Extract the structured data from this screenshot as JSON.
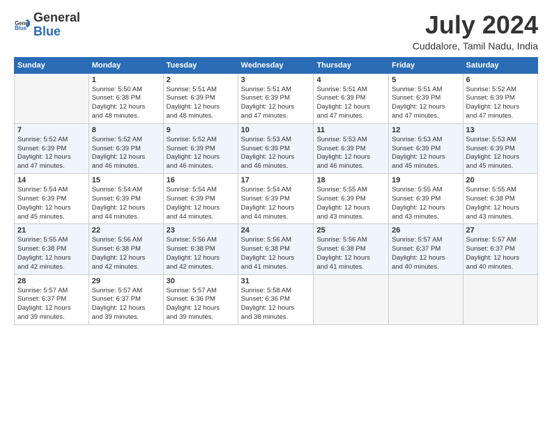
{
  "logo": {
    "general": "General",
    "blue": "Blue"
  },
  "title": "July 2024",
  "location": "Cuddalore, Tamil Nadu, India",
  "days_of_week": [
    "Sunday",
    "Monday",
    "Tuesday",
    "Wednesday",
    "Thursday",
    "Friday",
    "Saturday"
  ],
  "weeks": [
    [
      {
        "day": "",
        "info": ""
      },
      {
        "day": "1",
        "info": "Sunrise: 5:50 AM\nSunset: 6:38 PM\nDaylight: 12 hours\nand 48 minutes."
      },
      {
        "day": "2",
        "info": "Sunrise: 5:51 AM\nSunset: 6:39 PM\nDaylight: 12 hours\nand 48 minutes."
      },
      {
        "day": "3",
        "info": "Sunrise: 5:51 AM\nSunset: 6:39 PM\nDaylight: 12 hours\nand 47 minutes."
      },
      {
        "day": "4",
        "info": "Sunrise: 5:51 AM\nSunset: 6:39 PM\nDaylight: 12 hours\nand 47 minutes."
      },
      {
        "day": "5",
        "info": "Sunrise: 5:51 AM\nSunset: 6:39 PM\nDaylight: 12 hours\nand 47 minutes."
      },
      {
        "day": "6",
        "info": "Sunrise: 5:52 AM\nSunset: 6:39 PM\nDaylight: 12 hours\nand 47 minutes."
      }
    ],
    [
      {
        "day": "7",
        "info": "Sunrise: 5:52 AM\nSunset: 6:39 PM\nDaylight: 12 hours\nand 47 minutes."
      },
      {
        "day": "8",
        "info": "Sunrise: 5:52 AM\nSunset: 6:39 PM\nDaylight: 12 hours\nand 46 minutes."
      },
      {
        "day": "9",
        "info": "Sunrise: 5:52 AM\nSunset: 6:39 PM\nDaylight: 12 hours\nand 46 minutes."
      },
      {
        "day": "10",
        "info": "Sunrise: 5:53 AM\nSunset: 6:39 PM\nDaylight: 12 hours\nand 46 minutes."
      },
      {
        "day": "11",
        "info": "Sunrise: 5:53 AM\nSunset: 6:39 PM\nDaylight: 12 hours\nand 46 minutes."
      },
      {
        "day": "12",
        "info": "Sunrise: 5:53 AM\nSunset: 6:39 PM\nDaylight: 12 hours\nand 45 minutes."
      },
      {
        "day": "13",
        "info": "Sunrise: 5:53 AM\nSunset: 6:39 PM\nDaylight: 12 hours\nand 45 minutes."
      }
    ],
    [
      {
        "day": "14",
        "info": "Sunrise: 5:54 AM\nSunset: 6:39 PM\nDaylight: 12 hours\nand 45 minutes."
      },
      {
        "day": "15",
        "info": "Sunrise: 5:54 AM\nSunset: 6:39 PM\nDaylight: 12 hours\nand 44 minutes."
      },
      {
        "day": "16",
        "info": "Sunrise: 5:54 AM\nSunset: 6:39 PM\nDaylight: 12 hours\nand 44 minutes."
      },
      {
        "day": "17",
        "info": "Sunrise: 5:54 AM\nSunset: 6:39 PM\nDaylight: 12 hours\nand 44 minutes."
      },
      {
        "day": "18",
        "info": "Sunrise: 5:55 AM\nSunset: 6:39 PM\nDaylight: 12 hours\nand 43 minutes."
      },
      {
        "day": "19",
        "info": "Sunrise: 5:55 AM\nSunset: 6:39 PM\nDaylight: 12 hours\nand 43 minutes."
      },
      {
        "day": "20",
        "info": "Sunrise: 5:55 AM\nSunset: 6:38 PM\nDaylight: 12 hours\nand 43 minutes."
      }
    ],
    [
      {
        "day": "21",
        "info": "Sunrise: 5:55 AM\nSunset: 6:38 PM\nDaylight: 12 hours\nand 42 minutes."
      },
      {
        "day": "22",
        "info": "Sunrise: 5:56 AM\nSunset: 6:38 PM\nDaylight: 12 hours\nand 42 minutes."
      },
      {
        "day": "23",
        "info": "Sunrise: 5:56 AM\nSunset: 6:38 PM\nDaylight: 12 hours\nand 42 minutes."
      },
      {
        "day": "24",
        "info": "Sunrise: 5:56 AM\nSunset: 6:38 PM\nDaylight: 12 hours\nand 41 minutes."
      },
      {
        "day": "25",
        "info": "Sunrise: 5:56 AM\nSunset: 6:38 PM\nDaylight: 12 hours\nand 41 minutes."
      },
      {
        "day": "26",
        "info": "Sunrise: 5:57 AM\nSunset: 6:37 PM\nDaylight: 12 hours\nand 40 minutes."
      },
      {
        "day": "27",
        "info": "Sunrise: 5:57 AM\nSunset: 6:37 PM\nDaylight: 12 hours\nand 40 minutes."
      }
    ],
    [
      {
        "day": "28",
        "info": "Sunrise: 5:57 AM\nSunset: 6:37 PM\nDaylight: 12 hours\nand 39 minutes."
      },
      {
        "day": "29",
        "info": "Sunrise: 5:57 AM\nSunset: 6:37 PM\nDaylight: 12 hours\nand 39 minutes."
      },
      {
        "day": "30",
        "info": "Sunrise: 5:57 AM\nSunset: 6:36 PM\nDaylight: 12 hours\nand 39 minutes."
      },
      {
        "day": "31",
        "info": "Sunrise: 5:58 AM\nSunset: 6:36 PM\nDaylight: 12 hours\nand 38 minutes."
      },
      {
        "day": "",
        "info": ""
      },
      {
        "day": "",
        "info": ""
      },
      {
        "day": "",
        "info": ""
      }
    ]
  ]
}
